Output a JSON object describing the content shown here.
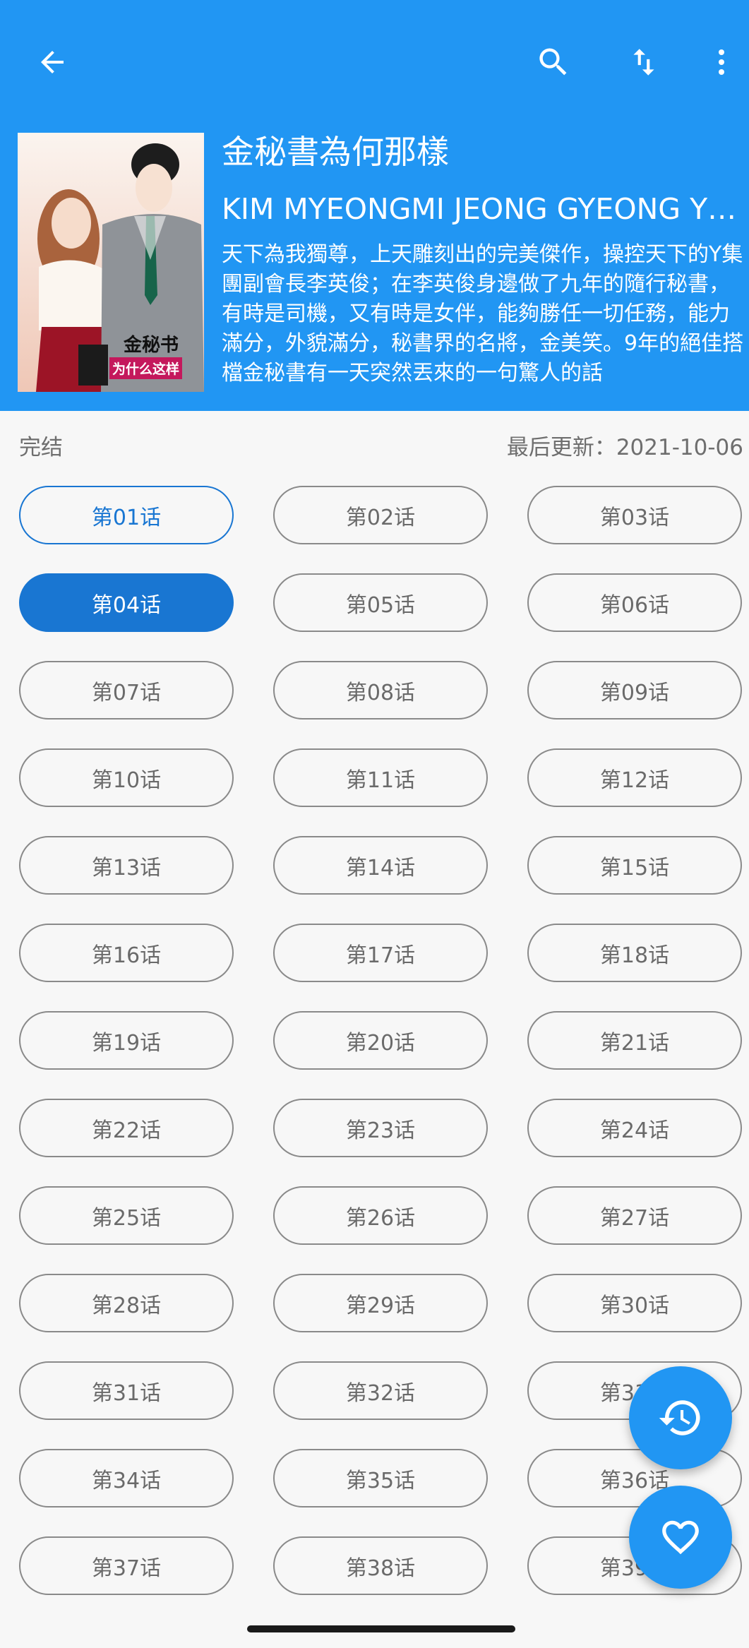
{
  "header": {
    "title": "金秘書為何那樣",
    "author": "KIM MYEONGMI JEONG GYEONG YUN",
    "description": "天下為我獨尊，上天雕刻出的完美傑作，操控天下的Y集團副會長李英俊；在李英俊身邊做了九年的隨行秘書，有時是司機，又有時是女伴，能夠勝任一切任務，能力滿分，外貌滿分，秘書界的名將，金美笑。9年的絕佳搭檔金秘書有一天突然丟來的一句驚人的話",
    "cover": {
      "text_line1": "金秘书",
      "text_line2": "为什么这样"
    },
    "colors": {
      "bar": "#2196f3",
      "accent": "#1976d2"
    }
  },
  "icons": {
    "back": "arrow-left-icon",
    "search": "search-icon",
    "sort": "sort-swap-icon",
    "more": "more-vertical-icon",
    "history": "history-icon",
    "favorite": "heart-icon"
  },
  "info": {
    "status": "完结",
    "last_update": "最后更新：2021-10-06"
  },
  "chapters": [
    {
      "label": "第01话",
      "state": "read"
    },
    {
      "label": "第02话",
      "state": "normal"
    },
    {
      "label": "第03话",
      "state": "normal"
    },
    {
      "label": "第04话",
      "state": "current"
    },
    {
      "label": "第05话",
      "state": "normal"
    },
    {
      "label": "第06话",
      "state": "normal"
    },
    {
      "label": "第07话",
      "state": "normal"
    },
    {
      "label": "第08话",
      "state": "normal"
    },
    {
      "label": "第09话",
      "state": "normal"
    },
    {
      "label": "第10话",
      "state": "normal"
    },
    {
      "label": "第11话",
      "state": "normal"
    },
    {
      "label": "第12话",
      "state": "normal"
    },
    {
      "label": "第13话",
      "state": "normal"
    },
    {
      "label": "第14话",
      "state": "normal"
    },
    {
      "label": "第15话",
      "state": "normal"
    },
    {
      "label": "第16话",
      "state": "normal"
    },
    {
      "label": "第17话",
      "state": "normal"
    },
    {
      "label": "第18话",
      "state": "normal"
    },
    {
      "label": "第19话",
      "state": "normal"
    },
    {
      "label": "第20话",
      "state": "normal"
    },
    {
      "label": "第21话",
      "state": "normal"
    },
    {
      "label": "第22话",
      "state": "normal"
    },
    {
      "label": "第23话",
      "state": "normal"
    },
    {
      "label": "第24话",
      "state": "normal"
    },
    {
      "label": "第25话",
      "state": "normal"
    },
    {
      "label": "第26话",
      "state": "normal"
    },
    {
      "label": "第27话",
      "state": "normal"
    },
    {
      "label": "第28话",
      "state": "normal"
    },
    {
      "label": "第29话",
      "state": "normal"
    },
    {
      "label": "第30话",
      "state": "normal"
    },
    {
      "label": "第31话",
      "state": "normal"
    },
    {
      "label": "第32话",
      "state": "normal"
    },
    {
      "label": "第33话",
      "state": "normal"
    },
    {
      "label": "第34话",
      "state": "normal"
    },
    {
      "label": "第35话",
      "state": "normal"
    },
    {
      "label": "第36话",
      "state": "normal"
    },
    {
      "label": "第37话",
      "state": "normal"
    },
    {
      "label": "第38话",
      "state": "normal"
    },
    {
      "label": "第39话",
      "state": "normal"
    }
  ]
}
